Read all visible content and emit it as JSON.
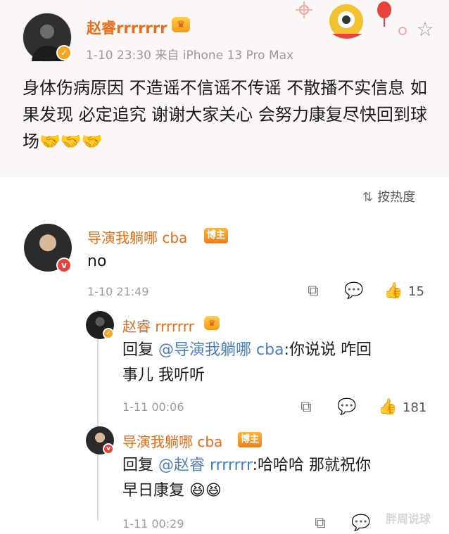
{
  "post": {
    "author": "赵睿rrrrrrr",
    "meta": "1-10 23:30  来自 iPhone 13 Pro Max",
    "text": "身体伤病原因 不造谣不信谣不传谣 不散播不实信息 如果发现 必定追究 谢谢大家关心 会努力康复尽快回到球场🤝🤝🤝"
  },
  "sort": {
    "label": "按热度"
  },
  "comments": [
    {
      "author": "导演我躺哪 cba",
      "badge": "博主",
      "text": "no",
      "time": "1-10 21:49",
      "likes": "15"
    }
  ],
  "replies": [
    {
      "author": "赵睿 rrrrrrr",
      "prefix": "回复 ",
      "mention": "@导演我躺哪 cba",
      "text_line1": ":你说说 咋回",
      "text_line2": "事儿 我听听",
      "time": "1-11 00:06",
      "likes": "181"
    },
    {
      "author": "导演我躺哪 cba",
      "badge": "博主",
      "prefix": "回复 ",
      "mention": "@赵睿 rrrrrrr",
      "text_line1": ":哈哈哈 那就祝你",
      "text_line2": "早日康复 😆😆",
      "time": "1-11 00:29"
    }
  ],
  "watermark": "胖周说球",
  "icons": {
    "share": "share-icon",
    "comment": "comment-icon",
    "like": "like-icon",
    "star": "star-icon"
  }
}
